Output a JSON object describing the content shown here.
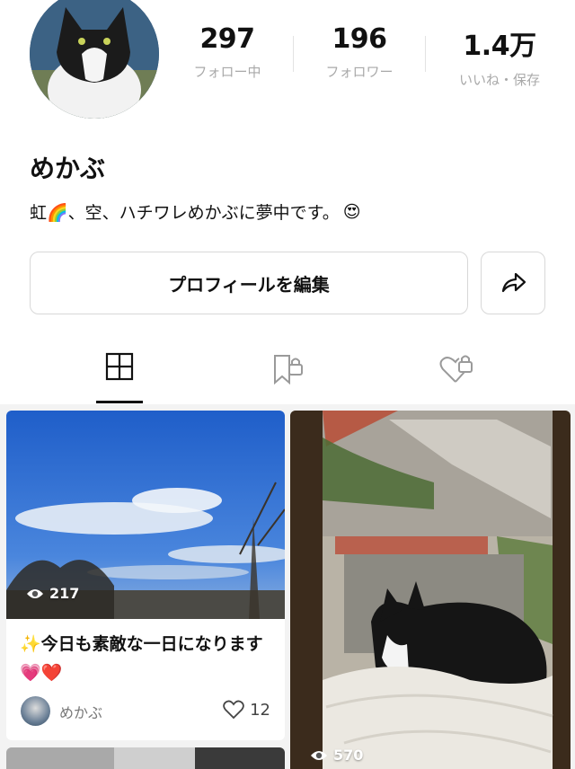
{
  "profile": {
    "name": "めかぶ",
    "bio_text": "虹🌈、空、ハチワレめかぶに夢中です。",
    "bio_emoji": "😍"
  },
  "stats": [
    {
      "value": "297",
      "label": "フォロー中"
    },
    {
      "value": "196",
      "label": "フォロワー"
    },
    {
      "value": "1.4万",
      "label": "いいね・保存"
    }
  ],
  "actions": {
    "edit_profile": "プロフィールを編集"
  },
  "tabs": [
    "posts",
    "saved-locked",
    "liked-locked"
  ],
  "icons": {
    "grid": "grid-icon",
    "bookmark_lock": "bookmark-lock-icon",
    "heart_lock": "heart-lock-icon",
    "share": "share-icon",
    "eye": "eye-icon",
    "heart": "heart-icon"
  },
  "posts": [
    {
      "views": "217",
      "title": "✨今日も素敵な一日になります💗❤️",
      "author": "めかぶ",
      "likes": "12"
    },
    {
      "views": "570"
    }
  ],
  "colors": {
    "tab_active": "#111111",
    "muted_text": "#a9a9a9",
    "feed_background": "#f3f3f3"
  }
}
